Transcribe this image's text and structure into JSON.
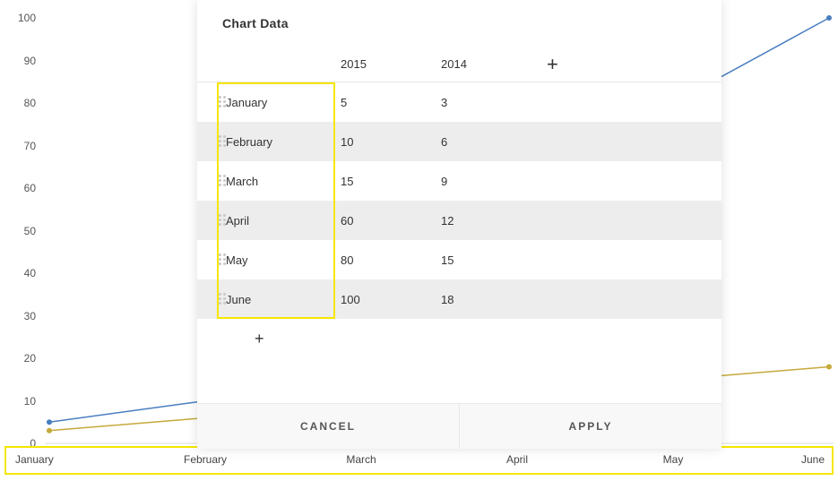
{
  "dialog": {
    "title": "Chart Data",
    "columns": [
      "2015",
      "2014"
    ],
    "add_column_label": "+",
    "add_row_label": "+",
    "rows": [
      {
        "month": "January",
        "v2015": "5",
        "v2014": "3"
      },
      {
        "month": "February",
        "v2015": "10",
        "v2014": "6"
      },
      {
        "month": "March",
        "v2015": "15",
        "v2014": "9"
      },
      {
        "month": "April",
        "v2015": "60",
        "v2014": "12"
      },
      {
        "month": "May",
        "v2015": "80",
        "v2014": "15"
      },
      {
        "month": "June",
        "v2015": "100",
        "v2014": "18"
      }
    ],
    "cancel_label": "CANCEL",
    "apply_label": "APPLY"
  },
  "y_axis": {
    "ticks": [
      "0",
      "10",
      "20",
      "30",
      "40",
      "50",
      "60",
      "70",
      "80",
      "90",
      "100"
    ]
  },
  "x_axis": {
    "labels": [
      "January",
      "February",
      "March",
      "April",
      "May",
      "June"
    ]
  },
  "chart_data": {
    "type": "line",
    "title": "",
    "xlabel": "",
    "ylabel": "",
    "ylim": [
      0,
      100
    ],
    "categories": [
      "January",
      "February",
      "March",
      "April",
      "May",
      "June"
    ],
    "series": [
      {
        "name": "2015",
        "values": [
          5,
          10,
          15,
          60,
          80,
          100
        ],
        "color": "#4a7ec1"
      },
      {
        "name": "2014",
        "values": [
          3,
          6,
          9,
          12,
          15,
          18
        ],
        "color": "#c6a93b"
      }
    ]
  }
}
